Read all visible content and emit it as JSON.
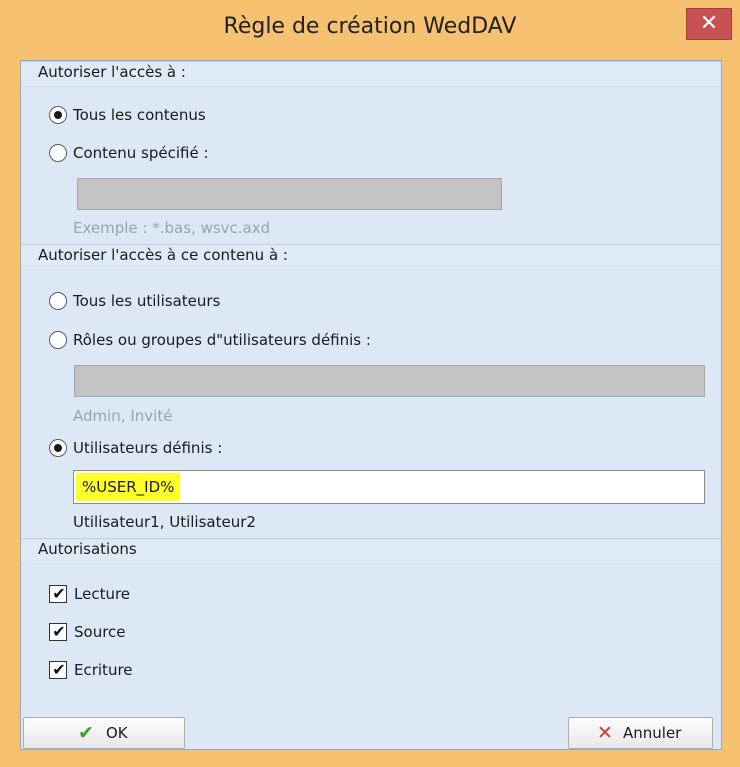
{
  "window": {
    "title": "Règle de création WedDAV",
    "close_glyph": "✕"
  },
  "access": {
    "header": "Autoriser l'accès à :",
    "options": [
      {
        "label": "Tous les contenus",
        "checked": true
      },
      {
        "label": "Contenu spécifié :",
        "checked": false
      }
    ],
    "content_field_value": "",
    "content_hint": "Exemple : *.bas, wsvc.axd"
  },
  "users": {
    "header": "Autoriser l'accès à ce contenu à :",
    "options": [
      {
        "label": "Tous les utilisateurs",
        "checked": false
      },
      {
        "label": "Rôles ou groupes d\"utilisateurs définis :",
        "checked": false
      },
      {
        "label": "Utilisateurs définis :",
        "checked": true
      }
    ],
    "roles_field_value": "",
    "roles_hint": "Admin, Invité",
    "users_field_value": "%USER_ID%",
    "users_hint": "Utilisateur1, Utilisateur2"
  },
  "permissions": {
    "header": "Autorisations",
    "items": [
      {
        "label": "Lecture",
        "checked": true
      },
      {
        "label": "Source",
        "checked": true
      },
      {
        "label": "Ecriture",
        "checked": true
      }
    ],
    "tick_glyph": "✔"
  },
  "buttons": {
    "ok_label": "OK",
    "ok_icon": "check-icon",
    "ok_glyph": "✔",
    "ok_icon_color": "#3aa02a",
    "cancel_label": "Annuler",
    "cancel_icon": "cross-icon",
    "cancel_glyph": "✕",
    "cancel_icon_color": "#d23a2a"
  },
  "colors": {
    "window_frame": "#f6c170",
    "client_bg": "#dce8f6",
    "close_button": "#c75050",
    "highlight": "#ffff2b"
  }
}
